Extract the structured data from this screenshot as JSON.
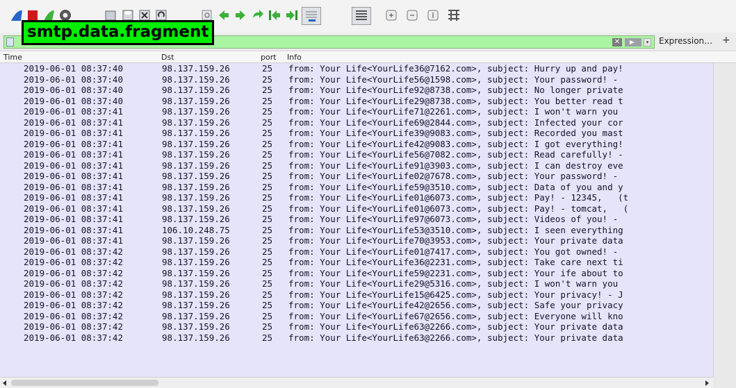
{
  "overlay_label": "smtp.data.fragment",
  "toolbar": {
    "icons": [
      "shark-fin-icon",
      "stop-icon",
      "restart-icon",
      "options-icon",
      "open-file-icon",
      "save-icon",
      "close-file-icon",
      "reload-icon",
      "find-icon",
      "go-back-icon",
      "go-forward-icon",
      "go-to-packet-icon",
      "go-first-icon",
      "go-last-icon",
      "autoscroll-icon",
      "colorize-icon",
      "zoom-in-icon",
      "zoom-out-icon",
      "normal-size-icon",
      "resize-columns-icon"
    ]
  },
  "filter": {
    "value": "",
    "clear_symbol": "✕",
    "dropdown_symbol": "▾",
    "expression_label": "Expression…",
    "add_label": "+"
  },
  "columns": [
    "Time",
    "Dst",
    "port",
    "Info"
  ],
  "rows": [
    {
      "time": "2019-06-01 08:37:40",
      "dst": "98.137.159.26",
      "port": "25",
      "info": "from: Your Life<YourLife36@7162.com>, subject: Hurry up and pay!"
    },
    {
      "time": "2019-06-01 08:37:40",
      "dst": "98.137.159.26",
      "port": "25",
      "info": "from: Your Life<YourLife56@1598.com>, subject: Your password! -"
    },
    {
      "time": "2019-06-01 08:37:40",
      "dst": "98.137.159.26",
      "port": "25",
      "info": "from: Your Life<YourLife92@8738.com>, subject: No longer private"
    },
    {
      "time": "2019-06-01 08:37:40",
      "dst": "98.137.159.26",
      "port": "25",
      "info": "from: Your Life<YourLife29@8738.com>, subject: You better read t"
    },
    {
      "time": "2019-06-01 08:37:41",
      "dst": "98.137.159.26",
      "port": "25",
      "info": "from: Your Life<YourLife71@2261.com>, subject: I won't warn you"
    },
    {
      "time": "2019-06-01 08:37:41",
      "dst": "98.137.159.26",
      "port": "25",
      "info": "from: Your Life<YourLife69@2844.com>, subject: Infected your cor"
    },
    {
      "time": "2019-06-01 08:37:41",
      "dst": "98.137.159.26",
      "port": "25",
      "info": "from: Your Life<YourLife39@9083.com>, subject: Recorded you mast"
    },
    {
      "time": "2019-06-01 08:37:41",
      "dst": "98.137.159.26",
      "port": "25",
      "info": "from: Your Life<YourLife42@9083.com>, subject: I got everything!"
    },
    {
      "time": "2019-06-01 08:37:41",
      "dst": "98.137.159.26",
      "port": "25",
      "info": "from: Your Life<YourLife56@7082.com>, subject: Read carefully! -"
    },
    {
      "time": "2019-06-01 08:37:41",
      "dst": "98.137.159.26",
      "port": "25",
      "info": "from: Your Life<YourLife91@3903.com>, subject: I can destroy eve"
    },
    {
      "time": "2019-06-01 08:37:41",
      "dst": "98.137.159.26",
      "port": "25",
      "info": "from: Your Life<YourLife02@7678.com>, subject: Your password! -"
    },
    {
      "time": "2019-06-01 08:37:41",
      "dst": "98.137.159.26",
      "port": "25",
      "info": "from: Your Life<YourLife59@3510.com>, subject: Data of you and y"
    },
    {
      "time": "2019-06-01 08:37:41",
      "dst": "98.137.159.26",
      "port": "25",
      "info": "from: Your Life<YourLife01@6073.com>, subject: Pay! - 12345,   (t"
    },
    {
      "time": "2019-06-01 08:37:41",
      "dst": "98.137.159.26",
      "port": "25",
      "info": "from: Your Life<YourLife01@6073.com>, subject: Pay! - tomcat,   ("
    },
    {
      "time": "2019-06-01 08:37:41",
      "dst": "98.137.159.26",
      "port": "25",
      "info": "from: Your Life<YourLife97@6073.com>, subject: Videos of you! -"
    },
    {
      "time": "2019-06-01 08:37:41",
      "dst": "106.10.248.75",
      "port": "25",
      "info": "from: Your Life<YourLife53@3510.com>, subject: I seen everything"
    },
    {
      "time": "2019-06-01 08:37:41",
      "dst": "98.137.159.26",
      "port": "25",
      "info": "from: Your Life<YourLife70@3953.com>, subject: Your private data"
    },
    {
      "time": "2019-06-01 08:37:42",
      "dst": "98.137.159.26",
      "port": "25",
      "info": "from: Your Life<YourLife01@7417.com>, subject: You got owned! -"
    },
    {
      "time": "2019-06-01 08:37:42",
      "dst": "98.137.159.26",
      "port": "25",
      "info": "from: Your Life<YourLife36@2231.com>, subject: Take care next ti"
    },
    {
      "time": "2019-06-01 08:37:42",
      "dst": "98.137.159.26",
      "port": "25",
      "info": "from: Your Life<YourLife59@2231.com>, subject: Your ife about to"
    },
    {
      "time": "2019-06-01 08:37:42",
      "dst": "98.137.159.26",
      "port": "25",
      "info": "from: Your Life<YourLife29@5316.com>, subject: I won't warn you"
    },
    {
      "time": "2019-06-01 08:37:42",
      "dst": "98.137.159.26",
      "port": "25",
      "info": "from: Your Life<YourLife15@6425.com>, subject: Your privacy! - J"
    },
    {
      "time": "2019-06-01 08:37:42",
      "dst": "98.137.159.26",
      "port": "25",
      "info": "from: Your Life<YourLife42@2656.com>, subject: Safe your privacy"
    },
    {
      "time": "2019-06-01 08:37:42",
      "dst": "98.137.159.26",
      "port": "25",
      "info": "from: Your Life<YourLife67@2656.com>, subject: Everyone will kno"
    },
    {
      "time": "2019-06-01 08:37:42",
      "dst": "98.137.159.26",
      "port": "25",
      "info": "from: Your Life<YourLife63@2266.com>, subject: Your private data"
    },
    {
      "time": "2019-06-01 08:37:42",
      "dst": "98.137.159.26",
      "port": "25",
      "info": "from: Your Life<YourLife63@2266.com>, subject: Your private data"
    }
  ]
}
